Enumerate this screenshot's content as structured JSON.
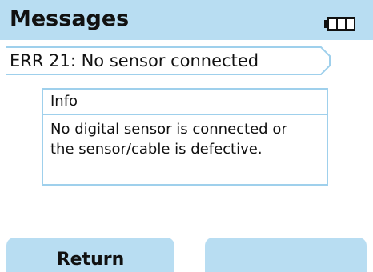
{
  "header": {
    "title": "Messages",
    "battery_icon": "battery-full-icon"
  },
  "message": {
    "error_text": "ERR 21: No sensor connected"
  },
  "info_panel": {
    "heading": "Info",
    "line1": "No digital sensor is connected or",
    "line2": "the sensor/cable is defective."
  },
  "softkeys": {
    "left_label": "Return",
    "right_label": ""
  },
  "colors": {
    "accent": "#b8ddf2",
    "border": "#9fd0ec",
    "text": "#111111"
  }
}
